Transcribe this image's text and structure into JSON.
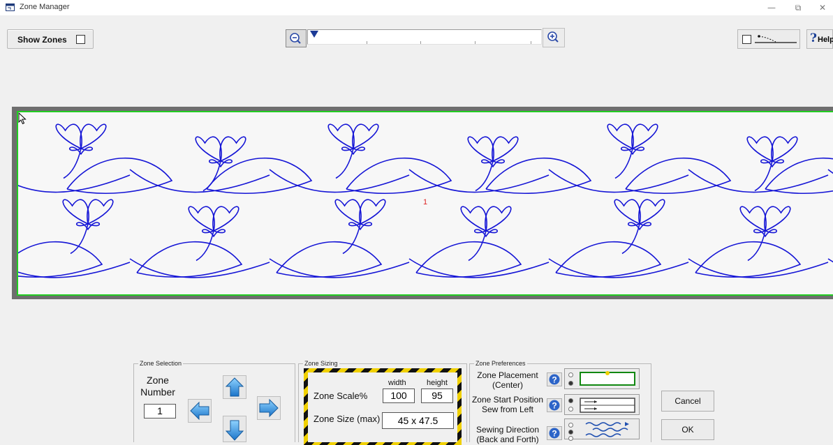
{
  "window": {
    "title": "Zone Manager",
    "minimize_glyph": "—",
    "restore_glyph": "⧉",
    "close_glyph": "✕"
  },
  "toolbar": {
    "show_zones_label": "Show Zones",
    "show_zones_checked": false,
    "help_glyph": "?",
    "help_label": "Help"
  },
  "canvas": {
    "zone_marker": "1",
    "pattern_color": "#1515d6",
    "border_color": "#22cc22"
  },
  "zone_selection": {
    "legend": "Zone Selection",
    "zone_label_line1": "Zone",
    "zone_label_line2": "Number",
    "zone_number": "1"
  },
  "zone_sizing": {
    "legend": "Zone Sizing",
    "scale_label": "Zone Scale%",
    "width_label": "width",
    "height_label": "height",
    "width_value": "100",
    "height_value": "95",
    "size_label": "Zone Size (max)",
    "size_value": "45 x 47.5"
  },
  "zone_preferences": {
    "legend": "Zone Preferences",
    "placement_line1": "Zone Placement",
    "placement_line2": "(Center)",
    "start_line1": "Zone Start Position",
    "start_line2": "Sew from Left",
    "direction_line1": "Sewing Direction",
    "direction_line2": "(Back and Forth)"
  },
  "dialog_buttons": {
    "cancel": "Cancel",
    "ok": "OK"
  },
  "icons": [
    "app-icon",
    "zoom-out-icon",
    "zoom-in-icon",
    "zoom-thumb-icon",
    "help-icon",
    "arrow-left-icon",
    "arrow-up-icon",
    "arrow-right-icon",
    "arrow-down-icon",
    "question-icon",
    "cursor-icon"
  ]
}
